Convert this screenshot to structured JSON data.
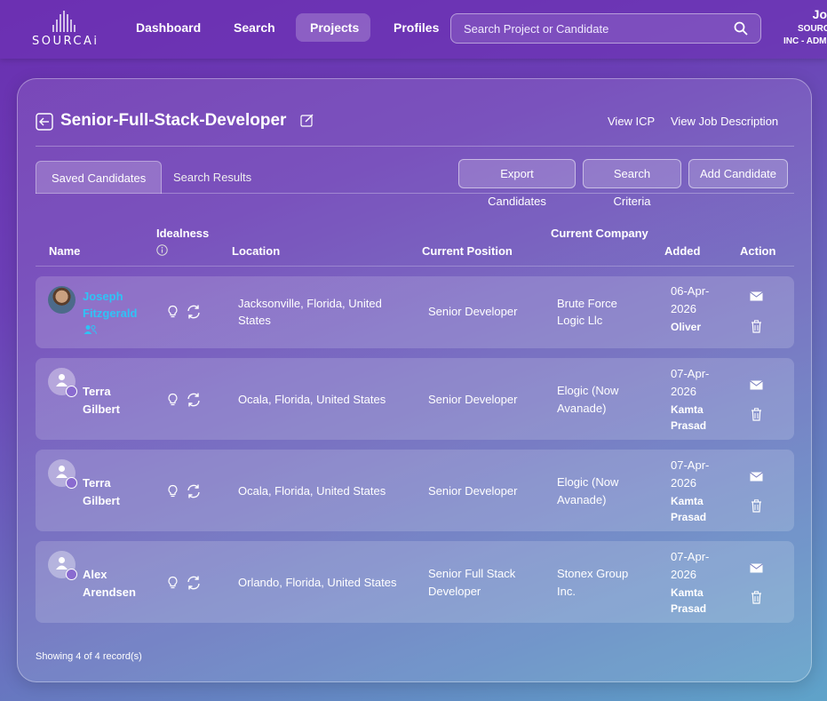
{
  "brand": {
    "logo_text": "SOURCAi"
  },
  "nav": {
    "items": [
      "Dashboard",
      "Search",
      "Projects",
      "Profiles"
    ],
    "active": "Projects"
  },
  "search": {
    "placeholder": "Search Project or Candidate"
  },
  "user": {
    "name": "Jo",
    "org": "SOURC",
    "role": "INC - ADM"
  },
  "project": {
    "title": "Senior-Full-Stack-Developer",
    "links": {
      "view_icp": "View ICP",
      "view_jd": "View Job Description"
    }
  },
  "tabs": {
    "saved": "Saved Candidates",
    "results": "Search Results"
  },
  "actions": {
    "export": "Export Candidates",
    "criteria": "Search Criteria",
    "add": "Add Candidate"
  },
  "table": {
    "headers": {
      "name": "Name",
      "idealness": "Idealness",
      "location": "Location",
      "position": "Current Position",
      "company": "Current Company",
      "added": "Added",
      "action": "Action"
    },
    "rows": [
      {
        "first": "Joseph",
        "last": "Fitzgerald",
        "location_1": "Jacksonville, Florida, United",
        "location_2": "States",
        "position_1": "Senior Developer",
        "position_2": "",
        "company_1": "Brute Force",
        "company_2": "Logic Llc",
        "date_1": "06-Apr-",
        "date_2": "2026",
        "by_1": "Oliver",
        "by_2": ""
      },
      {
        "first": "Terra",
        "last": "Gilbert",
        "location_1": "Ocala, Florida, United States",
        "location_2": "",
        "position_1": "Senior Developer",
        "position_2": "",
        "company_1": "Elogic (Now",
        "company_2": "Avanade)",
        "date_1": "07-Apr-",
        "date_2": "2026",
        "by_1": "Kamta",
        "by_2": "Prasad"
      },
      {
        "first": "Terra",
        "last": "Gilbert",
        "location_1": "Ocala, Florida, United States",
        "location_2": "",
        "position_1": "Senior Developer",
        "position_2": "",
        "company_1": "Elogic (Now",
        "company_2": "Avanade)",
        "date_1": "07-Apr-",
        "date_2": "2026",
        "by_1": "Kamta",
        "by_2": "Prasad"
      },
      {
        "first": "Alex",
        "last": "Arendsen",
        "location_1": "Orlando, Florida, United States",
        "location_2": "",
        "position_1": "Senior Full Stack",
        "position_2": "Developer",
        "company_1": "Stonex Group",
        "company_2": "Inc.",
        "date_1": "07-Apr-",
        "date_2": "2026",
        "by_1": "Kamta",
        "by_2": "Prasad"
      }
    ]
  },
  "footer": {
    "records": "Showing 4 of 4 record(s)"
  },
  "colors": {
    "link_name": "#2fc3f5",
    "accent": "#6a2fb0"
  }
}
